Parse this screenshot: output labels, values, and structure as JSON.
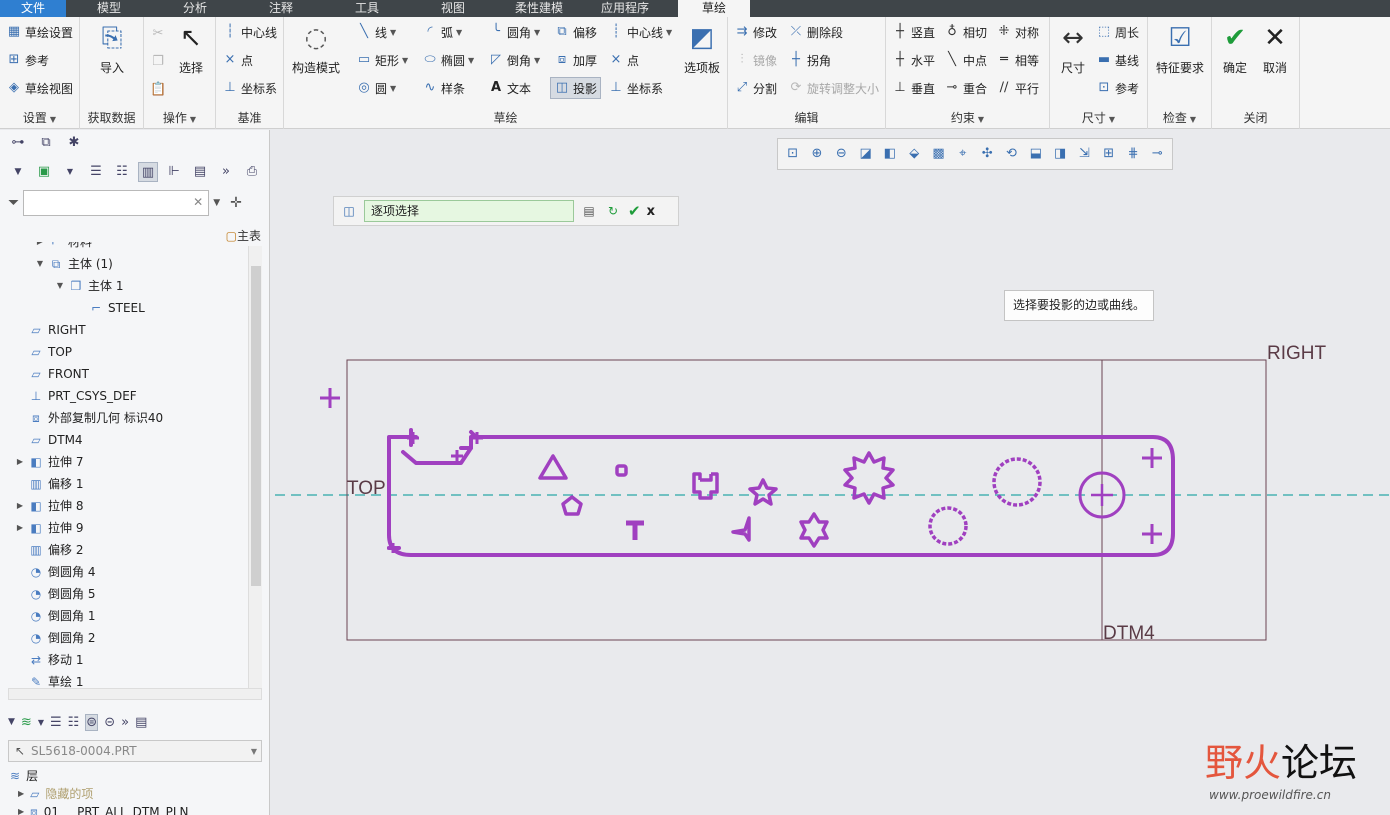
{
  "menubar": {
    "tabs": [
      "文件",
      "模型",
      "分析",
      "注释",
      "工具",
      "视图",
      "柔性建模",
      "应用程序",
      "草绘"
    ]
  },
  "ribbon": {
    "setup": {
      "sketch_setup": "草绘设置",
      "references": "参考",
      "sketch_view": "草绘视图",
      "label": "设置"
    },
    "get_data": {
      "import": "导入",
      "label": "获取数据"
    },
    "operations": {
      "select": "选择",
      "label": "操作"
    },
    "datum": {
      "centerline": "中心线",
      "point": "点",
      "csys": "坐标系",
      "label": "基准"
    },
    "construction": {
      "mode": "构造模式"
    },
    "sketching": {
      "line": "线",
      "rectangle": "矩形",
      "circle": "圆",
      "arc": "弧",
      "ellipse": "椭圆",
      "spline": "样条",
      "fillet": "圆角",
      "chamfer": "倒角",
      "text": "文本",
      "offset": "偏移",
      "thicken": "加厚",
      "project": "投影",
      "centerline": "中心线",
      "point": "点",
      "csys": "坐标系",
      "label": "草绘"
    },
    "palette": "选项板",
    "editing": {
      "modify": "修改",
      "mirror": "镜像",
      "divide": "分割",
      "delete_segment": "删除段",
      "corner": "拐角",
      "rotate_resize": "旋转调整大小",
      "label": "编辑"
    },
    "constraints": {
      "vertical": "竖直",
      "horizontal": "水平",
      "perpendicular": "垂直",
      "tangent": "相切",
      "midpoint": "中点",
      "coincident": "重合",
      "symmetric": "对称",
      "equal": "相等",
      "parallel": "平行",
      "label": "约束"
    },
    "dimension": {
      "dimension": "尺寸",
      "perimeter": "周长",
      "baseline": "基线",
      "reference": "参考",
      "label": "尺寸"
    },
    "inspect": {
      "feature_requirements": "特征要求",
      "label": "检查"
    },
    "close": {
      "ok": "确定",
      "cancel": "取消",
      "label": "关闭"
    }
  },
  "model_tree": {
    "main_table": "主表",
    "items": [
      {
        "label": "材料",
        "indent": 2,
        "icon": "material-icon",
        "expand": "right"
      },
      {
        "label": "主体 (1)",
        "indent": 2,
        "icon": "bodies-icon",
        "expand": "down"
      },
      {
        "label": "主体 1",
        "indent": 3,
        "icon": "body-icon",
        "expand": "down"
      },
      {
        "label": "STEEL",
        "indent": 4,
        "icon": "material-icon",
        "expand": ""
      },
      {
        "label": "RIGHT",
        "indent": 1,
        "icon": "datum-plane-icon",
        "expand": ""
      },
      {
        "label": "TOP",
        "indent": 1,
        "icon": "datum-plane-icon",
        "expand": ""
      },
      {
        "label": "FRONT",
        "indent": 1,
        "icon": "datum-plane-icon",
        "expand": ""
      },
      {
        "label": "PRT_CSYS_DEF",
        "indent": 1,
        "icon": "csys-icon",
        "expand": ""
      },
      {
        "label": "外部复制几何 标识40",
        "indent": 1,
        "icon": "copy-geom-icon",
        "expand": ""
      },
      {
        "label": "DTM4",
        "indent": 1,
        "icon": "datum-plane-icon",
        "expand": ""
      },
      {
        "label": "拉伸 7",
        "indent": 1,
        "icon": "extrude-icon",
        "expand": "right"
      },
      {
        "label": "偏移 1",
        "indent": 1,
        "icon": "offset-icon",
        "expand": ""
      },
      {
        "label": "拉伸 8",
        "indent": 1,
        "icon": "extrude-icon",
        "expand": "right"
      },
      {
        "label": "拉伸 9",
        "indent": 1,
        "icon": "extrude-icon",
        "expand": "right"
      },
      {
        "label": "偏移 2",
        "indent": 1,
        "icon": "offset-icon",
        "expand": ""
      },
      {
        "label": "倒圆角 4",
        "indent": 1,
        "icon": "round-icon",
        "expand": ""
      },
      {
        "label": "倒圆角 5",
        "indent": 1,
        "icon": "round-icon",
        "expand": ""
      },
      {
        "label": "倒圆角 1",
        "indent": 1,
        "icon": "round-icon",
        "expand": ""
      },
      {
        "label": "倒圆角 2",
        "indent": 1,
        "icon": "round-icon",
        "expand": ""
      },
      {
        "label": "移动 1",
        "indent": 1,
        "icon": "move-icon",
        "expand": ""
      },
      {
        "label": "草绘 1",
        "indent": 1,
        "icon": "sketch-icon",
        "expand": ""
      }
    ]
  },
  "layer_tree": {
    "model": "SL5618-0004.PRT",
    "items": [
      {
        "label": "层",
        "indent": 0
      },
      {
        "label": "隐藏的项",
        "indent": 1
      },
      {
        "label": "01___PRT_ALL_DTM_PLN",
        "indent": 1
      }
    ]
  },
  "dashboard": {
    "collector": "逐项选择",
    "ok": "✔",
    "cancel": "x"
  },
  "tooltip": "选择要投影的边或曲线。",
  "datum_labels": {
    "right": "RIGHT",
    "top": "TOP",
    "dtm4": "DTM4"
  },
  "colors": {
    "accent": "#2f7fd1",
    "sketch": "#a040c0",
    "datum": "#6b4452",
    "axis": "#2aa7a7"
  },
  "watermark": {
    "part1": "野火",
    "part2": "论坛",
    "url": "www.proewildfire.cn"
  }
}
